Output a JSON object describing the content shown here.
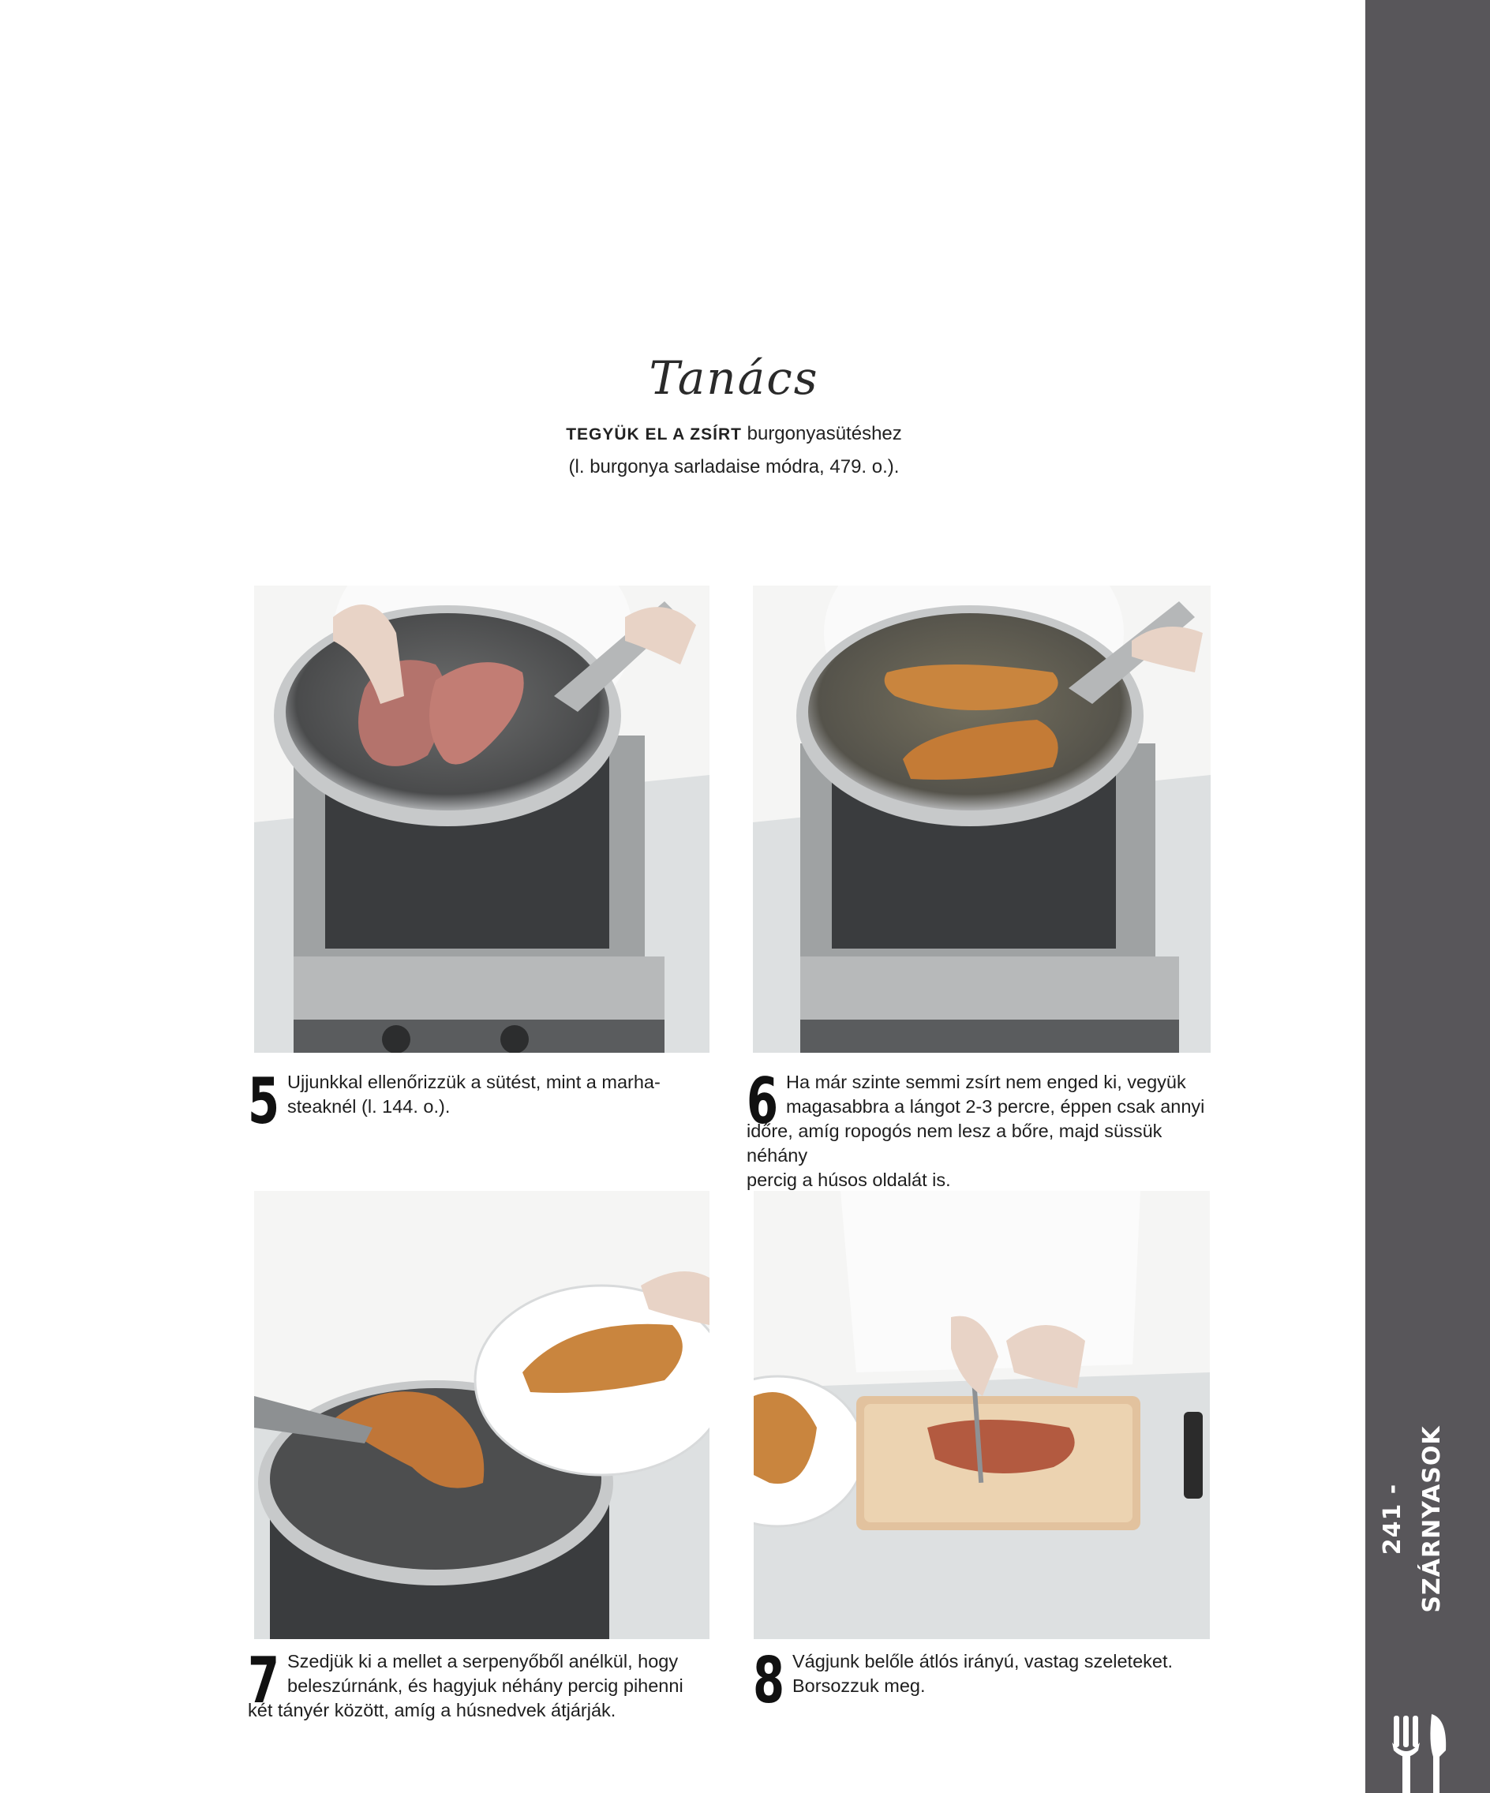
{
  "side": {
    "label": "241 - SZÁRNYASOK",
    "icon": "cutlery-icon",
    "color": "#58565a"
  },
  "tip": {
    "title": "Tanács",
    "highlight": "TEGYÜK EL A ZSÍRT",
    "line1_rest": " burgonyasütéshez",
    "line2": "(l. burgonya sarladaise módra, 479. o.)."
  },
  "steps": [
    {
      "number": "5",
      "text": "Ujjunkkal ellenőrizzük a sütést, mint a marha-steaknél (l. 144. o.).",
      "line1": "Ujjunkkal ellenőrizzük a sütést, mint a marha-",
      "line2": "steaknél (l. 144. o.)."
    },
    {
      "number": "6",
      "line1": "Ha már szinte semmi zsírt nem enged ki, vegyük",
      "line2": "magasabbra a lángot 2-3 percre, éppen csak annyi",
      "line3": "időre, amíg ropogós nem lesz a bőre, majd süssük néhány",
      "line4": "percig a húsos oldalát is."
    },
    {
      "number": "7",
      "line1": "Szedjük ki a mellet a serpenyőből anélkül, hogy",
      "line2": "beleszúrnánk, és hagyjuk néhány percig pihenni",
      "line3": "két tányér között, amíg a húsnedvek átjárják."
    },
    {
      "number": "8",
      "line1": "Vágjunk belőle átlós irányú, vastag szeleteket.",
      "line2": "Borsozzuk meg."
    }
  ],
  "photos": [
    {
      "name": "photo-step-5",
      "subject": "chef pressing duck breasts in pan"
    },
    {
      "name": "photo-step-6",
      "subject": "crispy scored duck breasts in pan"
    },
    {
      "name": "photo-step-7",
      "subject": "tongs moving duck breast to plate"
    },
    {
      "name": "photo-step-8",
      "subject": "slicing duck breast on cutting board"
    }
  ]
}
